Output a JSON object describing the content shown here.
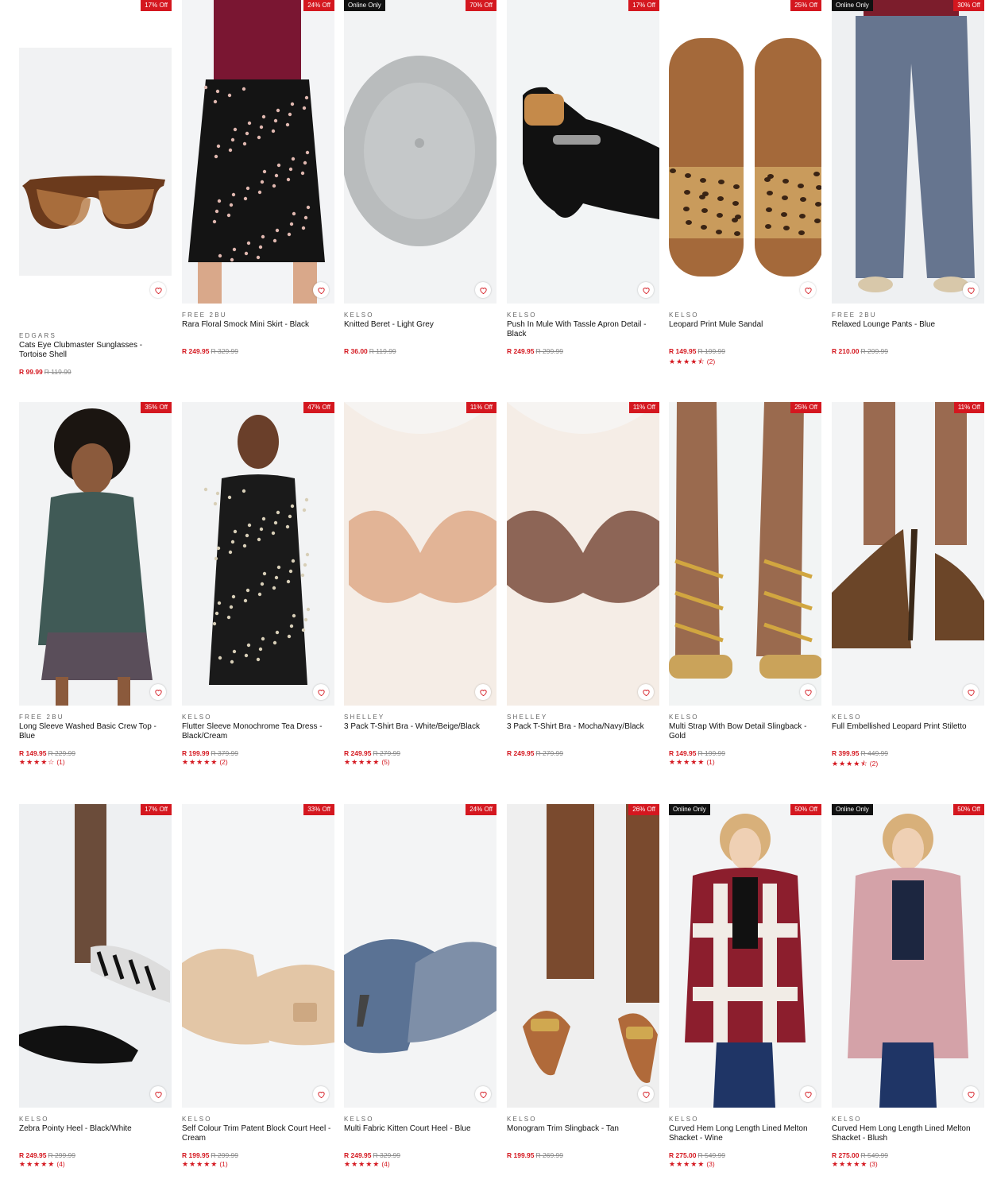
{
  "currency": "R",
  "colors": {
    "accent": "#d4171f",
    "online_badge": "#111111"
  },
  "products": [
    {
      "brand": "EDGARS",
      "name": "Cats Eye Clubmaster Sunglasses - Tortoise Shell",
      "price": "R 99.99",
      "was": "R 119.99",
      "discount": "17% Off",
      "online": "",
      "stars": "",
      "reviews": "",
      "icon": "sunglasses"
    },
    {
      "brand": "FREE 2BU",
      "name": "Rara Floral Smock Mini Skirt - Black",
      "price": "R 249.95",
      "was": "R 329.99",
      "discount": "24% Off",
      "online": "",
      "stars": "",
      "reviews": "",
      "icon": "skirt"
    },
    {
      "brand": "KELSO",
      "name": "Knitted Beret - Light Grey",
      "price": "R 36.00",
      "was": "R 119.99",
      "discount": "70% Off",
      "online": "Online Only",
      "stars": "",
      "reviews": "",
      "icon": "beret"
    },
    {
      "brand": "KELSO",
      "name": "Push In Mule With Tassle Apron Detail - Black",
      "price": "R 249.95",
      "was": "R 299.99",
      "discount": "17% Off",
      "online": "",
      "stars": "",
      "reviews": "",
      "icon": "mule"
    },
    {
      "brand": "KELSO",
      "name": "Leopard Print Mule Sandal",
      "price": "R 149.95",
      "was": "R 199.99",
      "discount": "25% Off",
      "online": "",
      "stars": "★★★★⯪",
      "reviews": "(2)",
      "icon": "sandal"
    },
    {
      "brand": "FREE 2BU",
      "name": "Relaxed Lounge Pants - Blue",
      "price": "R 210.00",
      "was": "R 299.99",
      "discount": "30% Off",
      "online": "Online Only",
      "stars": "",
      "reviews": "",
      "icon": "pants"
    },
    {
      "brand": "FREE 2BU",
      "name": "Long Sleeve Washed Basic Crew Top - Blue",
      "price": "R 149.95",
      "was": "R 229.99",
      "discount": "35% Off",
      "online": "",
      "stars": "★★★★☆",
      "reviews": "(1)",
      "icon": "top"
    },
    {
      "brand": "KELSO",
      "name": "Flutter Sleeve Monochrome Tea Dress - Black/Cream",
      "price": "R 199.99",
      "was": "R 379.99",
      "discount": "47% Off",
      "online": "",
      "stars": "★★★★★",
      "reviews": "(2)",
      "icon": "dress"
    },
    {
      "brand": "SHELLEY",
      "name": "3 Pack T-Shirt Bra - White/Beige/Black",
      "price": "R 249.95",
      "was": "R 279.99",
      "discount": "11% Off",
      "online": "",
      "stars": "★★★★★",
      "reviews": "(5)",
      "icon": "bra-beige"
    },
    {
      "brand": "SHELLEY",
      "name": "3 Pack T-Shirt Bra - Mocha/Navy/Black",
      "price": "R 249.95",
      "was": "R 279.99",
      "discount": "11% Off",
      "online": "",
      "stars": "",
      "reviews": "",
      "icon": "bra-mocha"
    },
    {
      "brand": "KELSO",
      "name": "Multi Strap With Bow Detail Slingback - Gold",
      "price": "R 149.95",
      "was": "R 199.99",
      "discount": "25% Off",
      "online": "",
      "stars": "★★★★★",
      "reviews": "(1)",
      "icon": "gold-heel"
    },
    {
      "brand": "KELSO",
      "name": "Full Embellished Leopard Print Stiletto",
      "price": "R 399.95",
      "was": "R 449.99",
      "discount": "11% Off",
      "online": "",
      "stars": "★★★★⯪",
      "reviews": "(2)",
      "icon": "stiletto"
    },
    {
      "brand": "KELSO",
      "name": "Zebra Pointy Heel - Black/White",
      "price": "R 249.95",
      "was": "R 299.99",
      "discount": "17% Off",
      "online": "",
      "stars": "★★★★★",
      "reviews": "(4)",
      "icon": "zebra-heel"
    },
    {
      "brand": "KELSO",
      "name": "Self Colour Trim Patent Block Court Heel - Cream",
      "price": "R 199.95",
      "was": "R 299.99",
      "discount": "33% Off",
      "online": "",
      "stars": "★★★★★",
      "reviews": "(1)",
      "icon": "cream-heel"
    },
    {
      "brand": "KELSO",
      "name": "Multi Fabric Kitten Court Heel - Blue",
      "price": "R 249.95",
      "was": "R 329.99",
      "discount": "24% Off",
      "online": "",
      "stars": "★★★★★",
      "reviews": "(4)",
      "icon": "blue-heel"
    },
    {
      "brand": "KELSO",
      "name": "Monogram Trim Slingback - Tan",
      "price": "R 199.95",
      "was": "R 269.99",
      "discount": "26% Off",
      "online": "",
      "stars": "",
      "reviews": "",
      "icon": "tan-flat"
    },
    {
      "brand": "KELSO",
      "name": "Curved Hem Long Length Lined Melton Shacket - Wine",
      "price": "R 275.00",
      "was": "R 549.99",
      "discount": "50% Off",
      "online": "Online Only",
      "stars": "★★★★★",
      "reviews": "(3)",
      "icon": "shacket-wine"
    },
    {
      "brand": "KELSO",
      "name": "Curved Hem Long Length Lined Melton Shacket - Blush",
      "price": "R 275.00",
      "was": "R 549.99",
      "discount": "50% Off",
      "online": "Online Only",
      "stars": "★★★★★",
      "reviews": "(3)",
      "icon": "shacket-blush"
    }
  ]
}
